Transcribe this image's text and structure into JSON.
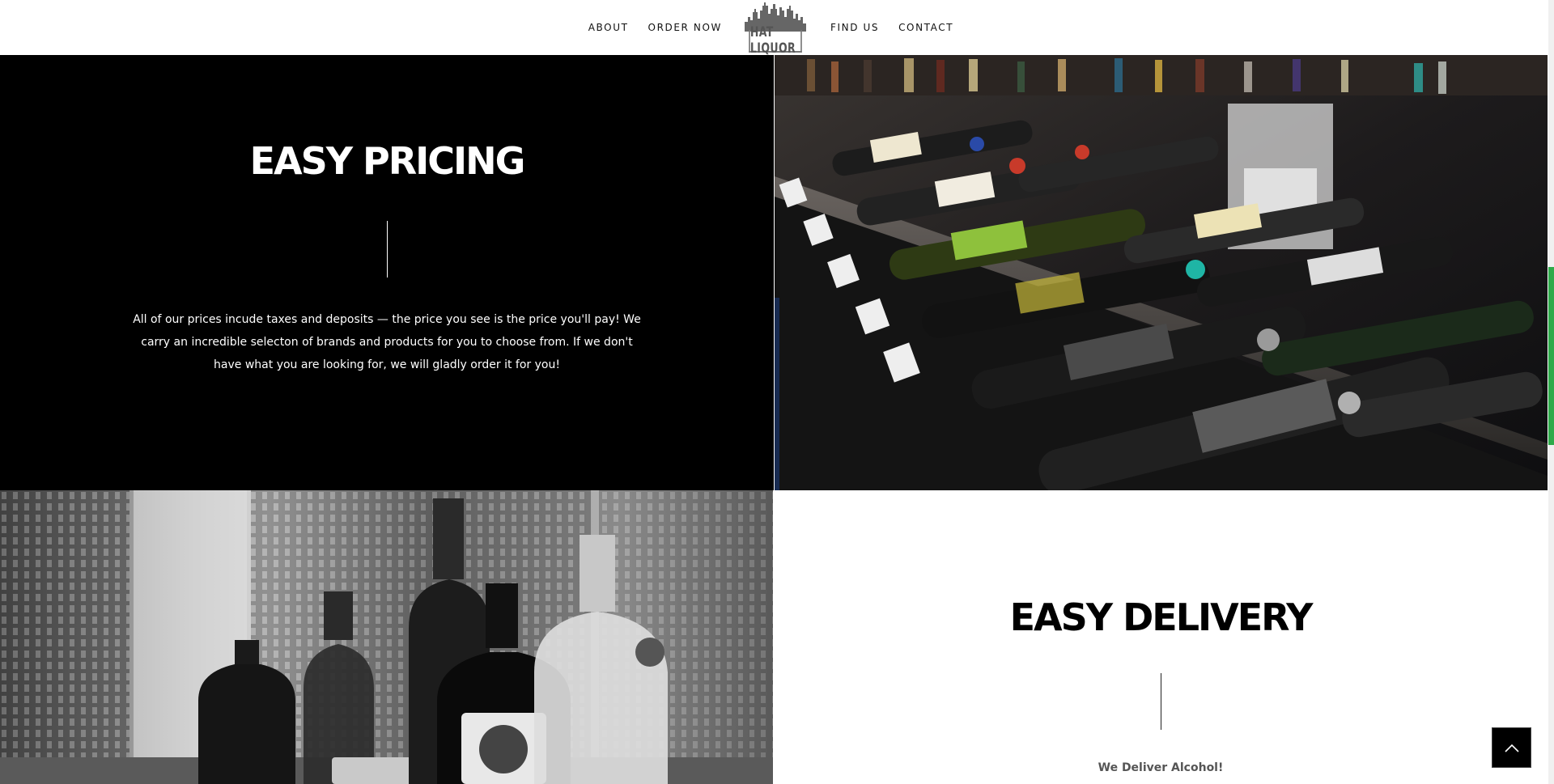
{
  "nav": {
    "left": [
      "ABOUT",
      "ORDER NOW"
    ],
    "right": [
      "FIND US",
      "CONTACT"
    ],
    "logo_text": "HAT LIQUOR"
  },
  "pricing": {
    "title": "EASY PRICING",
    "body": "All of our prices incude taxes and deposits — the price you see is the price you'll pay! We carry an incredible selecton of brands and products for you to choose from. If we don't have what you are looking for, we will gladly order it for you!"
  },
  "delivery": {
    "title": "EASY DELIVERY",
    "subtitle": "We Deliver Alcohol!"
  },
  "images": {
    "wine_photo": "wine-bottles-on-display-rack",
    "bottles_photo": "spirit-bottles-black-and-white"
  },
  "icons": {
    "back_to_top": "chevron-up-icon"
  },
  "colors": {
    "dark_section": "#000000",
    "light_section": "#ffffff",
    "scroll_accent": "#2eaa4a"
  }
}
